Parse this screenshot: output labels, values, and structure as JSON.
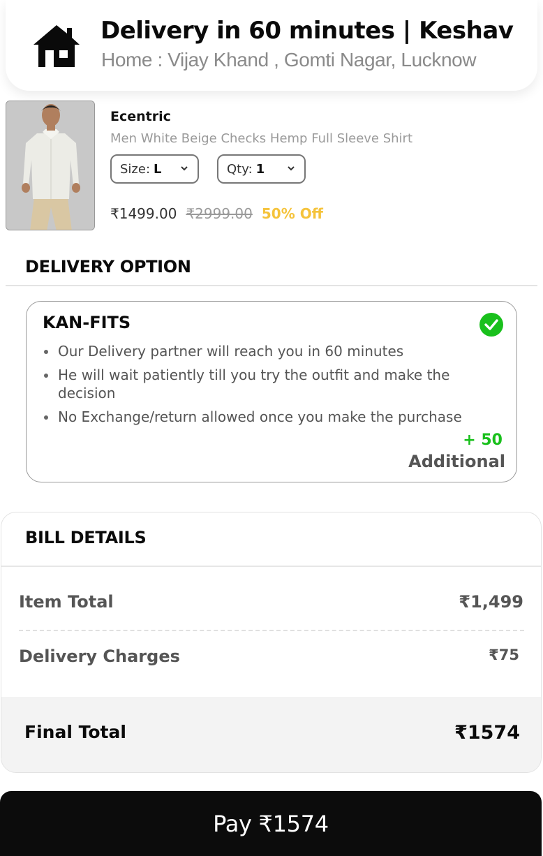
{
  "header": {
    "icon": "home-icon",
    "title": "Delivery in 60 minutes | Keshav",
    "address": "Home : Vijay Khand , Gomti Nagar, Lucknow"
  },
  "product": {
    "image_icon": "product-image",
    "brand": "Ecentric",
    "name": "Men White Beige Checks Hemp Full Sleeve Shirt",
    "size_label": "Size:",
    "size_value": "L",
    "qty_label": "Qty:",
    "qty_value": "1",
    "price": "₹1499.00",
    "mrp": "₹2999.00",
    "discount": "50% Off"
  },
  "delivery": {
    "section_title": "DELIVERY OPTION",
    "option_name": "KAN-FITS",
    "selected": true,
    "points": [
      "Our Delivery partner will reach you in 60 minutes",
      "He will wait patiently till you try the outfit and make the decision",
      "No Exchange/return allowed once you make the purchase"
    ],
    "extra_amount": "+ 50",
    "extra_label": "Additional"
  },
  "bill": {
    "title": "BILL DETAILS",
    "item_total_label": "Item Total",
    "item_total_value": "₹1,499",
    "delivery_label": "Delivery Charges",
    "delivery_value": "₹75",
    "final_label": "Final Total",
    "final_value": "₹1574"
  },
  "pay": {
    "label": "Pay ₹1574"
  },
  "colors": {
    "accent_green": "#19c01c",
    "discount_yellow": "#f5c33b",
    "pay_bg": "#0c0c0c"
  }
}
